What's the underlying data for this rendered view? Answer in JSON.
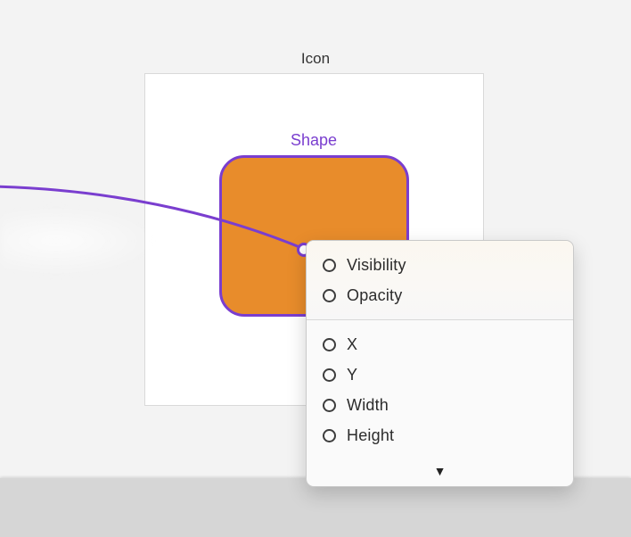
{
  "canvas": {
    "title": "Icon"
  },
  "node": {
    "label": "Shape"
  },
  "popover": {
    "sections": [
      {
        "items": [
          {
            "label": "Visibility"
          },
          {
            "label": "Opacity"
          }
        ]
      },
      {
        "items": [
          {
            "label": "X"
          },
          {
            "label": "Y"
          },
          {
            "label": "Width"
          },
          {
            "label": "Height"
          }
        ]
      }
    ]
  }
}
